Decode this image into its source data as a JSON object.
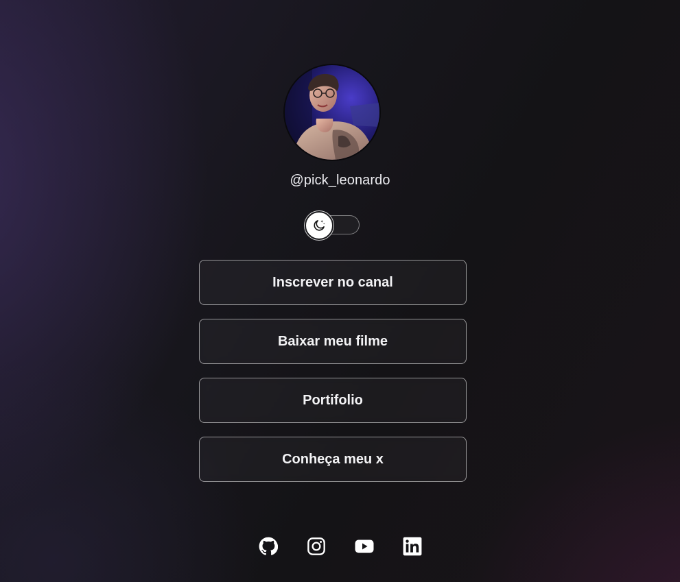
{
  "profile": {
    "username": "@pick_leonardo",
    "avatar_alt": "profile-photo"
  },
  "theme_toggle": {
    "icon": "moon-sparkle-icon",
    "state": "dark"
  },
  "links": [
    {
      "label": "Inscrever no canal"
    },
    {
      "label": "Baixar meu filme"
    },
    {
      "label": "Portifolio"
    },
    {
      "label": "Conheça meu x"
    }
  ],
  "socials": [
    {
      "icon": "github-icon"
    },
    {
      "icon": "instagram-icon"
    },
    {
      "icon": "youtube-icon"
    },
    {
      "icon": "linkedin-icon"
    }
  ],
  "colors": {
    "text": "#f2f2f4",
    "button_border": "#8a8a90",
    "background_dark": "#141316",
    "background_purple": "#2a2140"
  }
}
